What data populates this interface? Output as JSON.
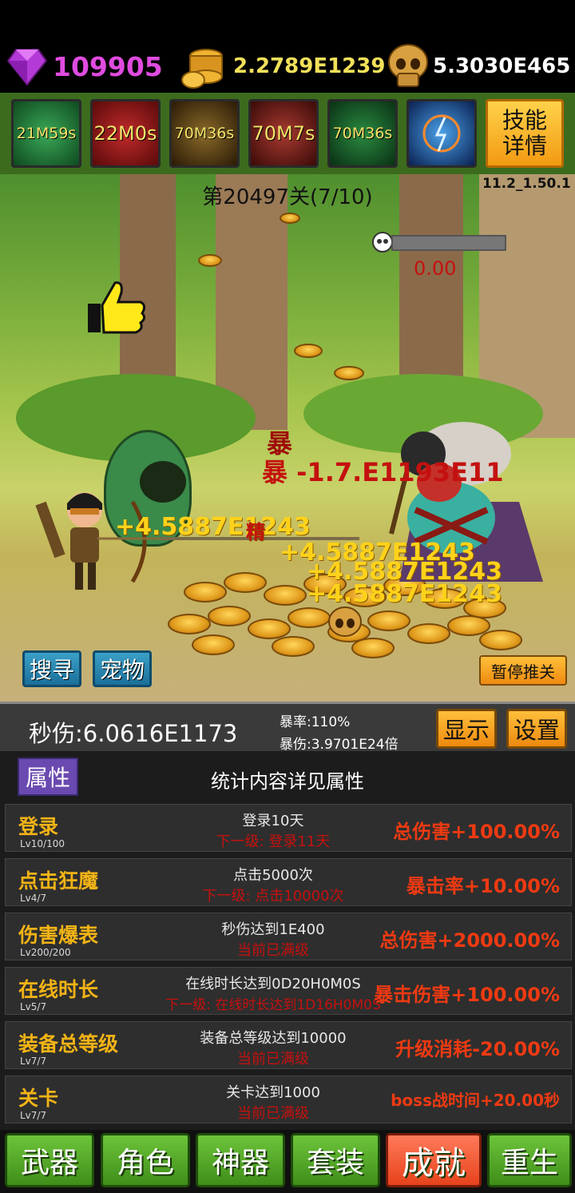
{
  "resources": {
    "gems": "109905",
    "gold": "2.2789E1239",
    "skulls": "5.3030E465"
  },
  "skills": [
    {
      "timer": "21M59s",
      "color": "#1f7a3a"
    },
    {
      "timer": "22M0s",
      "color": "#8a1414"
    },
    {
      "timer": "70M36s",
      "color": "#4a3a12"
    },
    {
      "timer": "70M7s",
      "color": "#6a1a18"
    },
    {
      "timer": "70M36s",
      "color": "#1a5a2a"
    },
    {
      "timer": "",
      "color": "#10306a"
    }
  ],
  "skill_detail_label": "技能\n详情",
  "version": "11.2_1.50.1",
  "stage": {
    "label": "第20497关(7/10)",
    "boss_timer": "0.00"
  },
  "damage_texts": {
    "crit_1": "暴 -1.7.E1193E11",
    "crit_2": "暴",
    "hit_1": "+4.5887E1243",
    "hit_2": "+4.5887E1243",
    "hit_3": "+4.5887E1243",
    "hit_4": "+4.5887E1243",
    "elite": "精"
  },
  "scene_buttons": {
    "search": "搜寻",
    "pet": "宠物",
    "pause": "暂停推关"
  },
  "stats": {
    "dps": "秒伤:6.0616E1173",
    "crit_rate": "暴率:110%",
    "crit_damage": "暴伤:3.9701E24倍",
    "show_btn": "显示",
    "settings_btn": "设置"
  },
  "achievements_header": {
    "tab": "属性",
    "note": "统计内容详见属性"
  },
  "achievements": [
    {
      "title": "登录",
      "level": "Lv10/100",
      "condition": "登录10天",
      "next": "下一级:  登录11天",
      "bonus": "总伤害+100.00%"
    },
    {
      "title": "点击狂魔",
      "level": "Lv4/7",
      "condition": "点击5000次",
      "next": "下一级:  点击10000次",
      "bonus": "暴击率+10.00%"
    },
    {
      "title": "伤害爆表",
      "level": "Lv200/200",
      "condition": "秒伤达到1E400",
      "next": "当前已满级",
      "bonus": "总伤害+2000.00%"
    },
    {
      "title": "在线时长",
      "level": "Lv5/7",
      "condition": "在线时长达到0D20H0M0S",
      "next": "下一级:  在线时长达到1D16H0M0S",
      "bonus": "暴击伤害+100.00%"
    },
    {
      "title": "装备总等级",
      "level": "Lv7/7",
      "condition": "装备总等级达到10000",
      "next": "当前已满级",
      "bonus": "升级消耗-20.00%"
    },
    {
      "title": "关卡",
      "level": "Lv7/7",
      "condition": "关卡达到1000",
      "next": "当前已满级",
      "bonus": "boss战时间+20.00秒"
    }
  ],
  "nav": {
    "weapon": "武器",
    "role": "角色",
    "artifact": "神器",
    "set": "套装",
    "achievement": "成就",
    "rebirth": "重生"
  }
}
